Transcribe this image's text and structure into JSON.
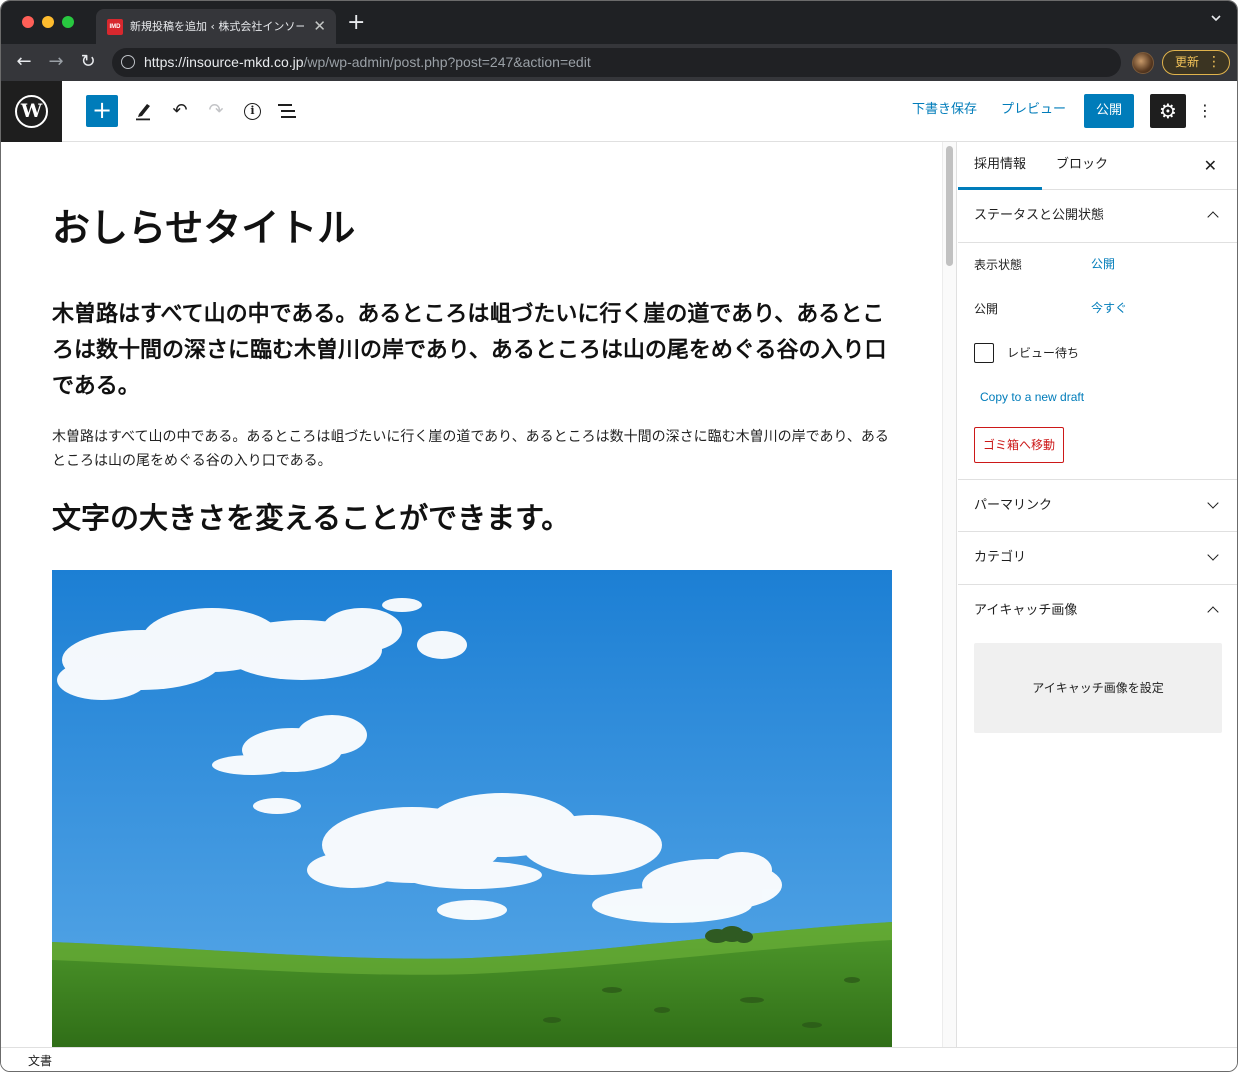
{
  "browser": {
    "tab_title": "新規投稿を追加 ‹ 株式会社インソース",
    "favicon_text": "IMD",
    "url_host": "https://insource-mkd.co.jp",
    "url_path": "/wp/wp-admin/post.php?post=247&action=edit",
    "update_label": "更新"
  },
  "editor_header": {
    "save_draft": "下書き保存",
    "preview": "プレビュー",
    "publish": "公開"
  },
  "post": {
    "title": "おしらせタイトル",
    "heading": "木曽路はすべて山の中である。あるところは岨づたいに行く崖の道であり、あるところは数十間の深さに臨む木曽川の岸であり、あるところは山の尾をめぐる谷の入り口である。",
    "paragraph": "木曽路はすべて山の中である。あるところは岨づたいに行く崖の道であり、あるところは数十間の深さに臨む木曽川の岸であり、あるところは山の尾をめぐる谷の入り口である。",
    "subheading": "文字の大きさを変えることができます。"
  },
  "sidebar": {
    "tabs": [
      "採用情報",
      "ブロック"
    ],
    "status_panel": {
      "title": "ステータスと公開状態",
      "visibility_label": "表示状態",
      "visibility_value": "公開",
      "publish_label": "公開",
      "publish_value": "今すぐ",
      "pending_review": "レビュー待ち",
      "copy_draft": "Copy to a new draft",
      "trash": "ゴミ箱へ移動"
    },
    "permalink": "パーマリンク",
    "categories": "カテゴリ",
    "featured_image": {
      "title": "アイキャッチ画像",
      "set_label": "アイキャッチ画像を設定"
    }
  },
  "footer": {
    "breadcrumb": "文書"
  },
  "colors": {
    "accent": "#007cba",
    "danger": "#cc1818"
  }
}
